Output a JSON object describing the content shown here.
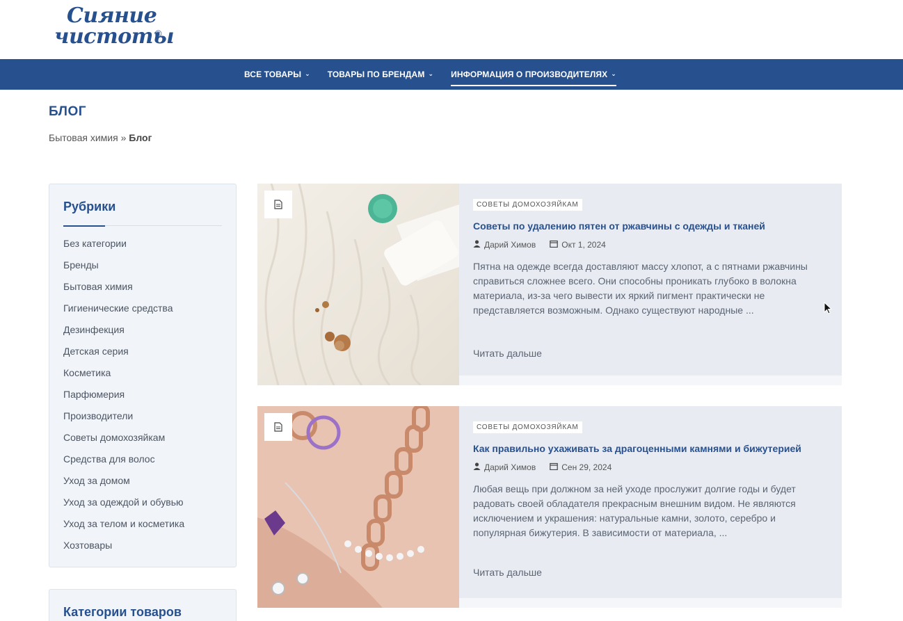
{
  "logo": {
    "line1": "Сияние",
    "line2": "чистоты",
    "reg": "®"
  },
  "nav": {
    "items": [
      {
        "label": "ВСЕ ТОВАРЫ"
      },
      {
        "label": "ТОВАРЫ ПО БРЕНДАМ"
      },
      {
        "label": "ИНФОРМАЦИЯ О ПРОИЗВОДИТЕЛЯХ"
      }
    ],
    "active_index": 2
  },
  "page": {
    "title": "БЛОГ"
  },
  "breadcrumb": {
    "home": "Бытовая химия",
    "sep": "»",
    "current": "Блог"
  },
  "sidebar": {
    "widget1": {
      "title": "Рубрики",
      "items": [
        "Без категории",
        "Бренды",
        "Бытовая химия",
        "Гигиенические средства",
        "Дезинфекция",
        "Детская серия",
        "Косметика",
        "Парфюмерия",
        "Производители",
        "Советы домохозяйкам",
        "Средства для волос",
        "Уход за домом",
        "Уход за одеждой и обувью",
        "Уход за телом и косметика",
        "Хозтовары"
      ]
    },
    "widget2": {
      "title": "Категории товаров"
    }
  },
  "posts": [
    {
      "category": "СОВЕТЫ ДОМОХОЗЯЙКАМ",
      "title": "Советы по удалению пятен от ржавчины с одежды и тканей",
      "author": "Дарий Химов",
      "date": "Окт 1, 2024",
      "excerpt": "Пятна на одежде всегда доставляют массу хлопот, а с пятнами ржавчины справиться сложнее всего. Они способны проникать глубоко в волокна материала, из-за чего вывести их яркий пигмент практически не представляется возможным. Однако существуют народные ...",
      "read_more": "Читать дальше"
    },
    {
      "category": "СОВЕТЫ ДОМОХОЗЯЙКАМ",
      "title": "Как правильно ухаживать за драгоценными камнями и бижутерией",
      "author": "Дарий Химов",
      "date": "Сен 29, 2024",
      "excerpt": "Любая вещь при должном за ней уходе прослужит долгие годы и будет радовать своей обладателя прекрасным внешним видом. Не являются исключением и украшения: натуральные камни, золото, серебро и популярная бижутерия. В зависимости от материала, ...",
      "read_more": "Читать дальше"
    }
  ],
  "colors": {
    "brand": "#27508f",
    "post_bg": "#e8ecf2",
    "sidebar_bg": "#f1f4f8"
  }
}
